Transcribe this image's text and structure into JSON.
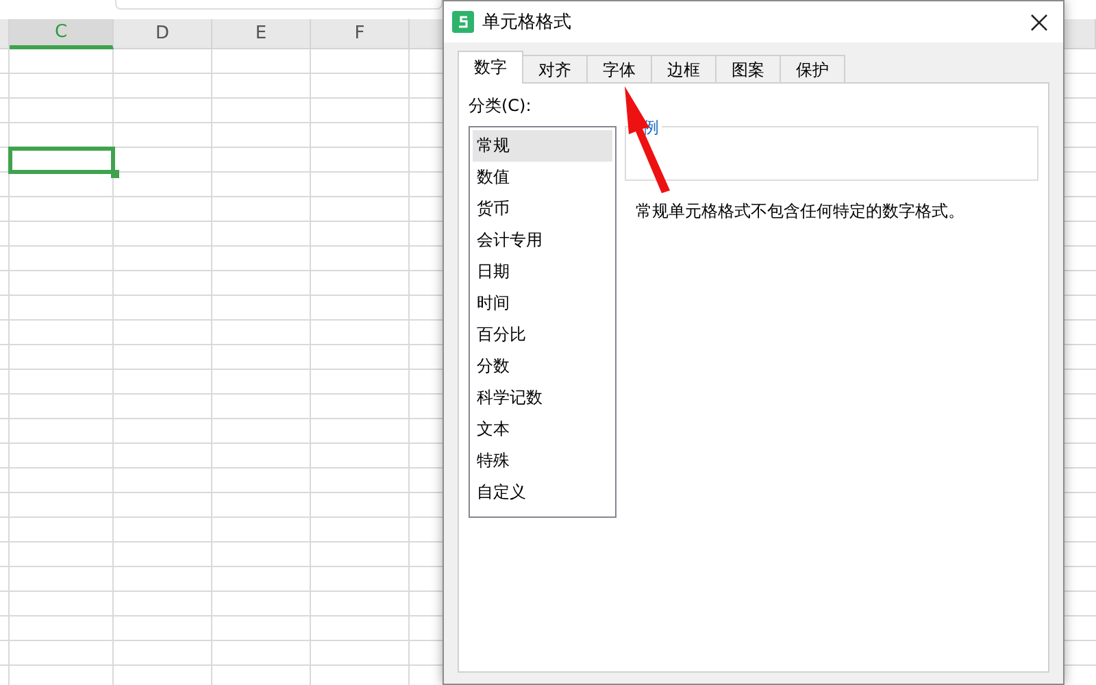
{
  "sheet": {
    "columns": [
      {
        "label": "C",
        "selected": true
      },
      {
        "label": "D",
        "selected": false
      },
      {
        "label": "E",
        "selected": false
      },
      {
        "label": "F",
        "selected": false
      }
    ]
  },
  "dialog": {
    "title": "单元格格式",
    "tabs": [
      {
        "label": "数字",
        "selected": true
      },
      {
        "label": "对齐",
        "selected": false
      },
      {
        "label": "字体",
        "selected": false
      },
      {
        "label": "边框",
        "selected": false
      },
      {
        "label": "图案",
        "selected": false
      },
      {
        "label": "保护",
        "selected": false
      }
    ],
    "category_label": "分类(C):",
    "categories": [
      {
        "label": "常规",
        "selected": true
      },
      {
        "label": "数值",
        "selected": false
      },
      {
        "label": "货币",
        "selected": false
      },
      {
        "label": "会计专用",
        "selected": false
      },
      {
        "label": "日期",
        "selected": false
      },
      {
        "label": "时间",
        "selected": false
      },
      {
        "label": "百分比",
        "selected": false
      },
      {
        "label": "分数",
        "selected": false
      },
      {
        "label": "科学记数",
        "selected": false
      },
      {
        "label": "文本",
        "selected": false
      },
      {
        "label": "特殊",
        "selected": false
      },
      {
        "label": "自定义",
        "selected": false
      }
    ],
    "sample_label": "例",
    "description": "常规单元格格式不包含任何特定的数字格式。"
  }
}
